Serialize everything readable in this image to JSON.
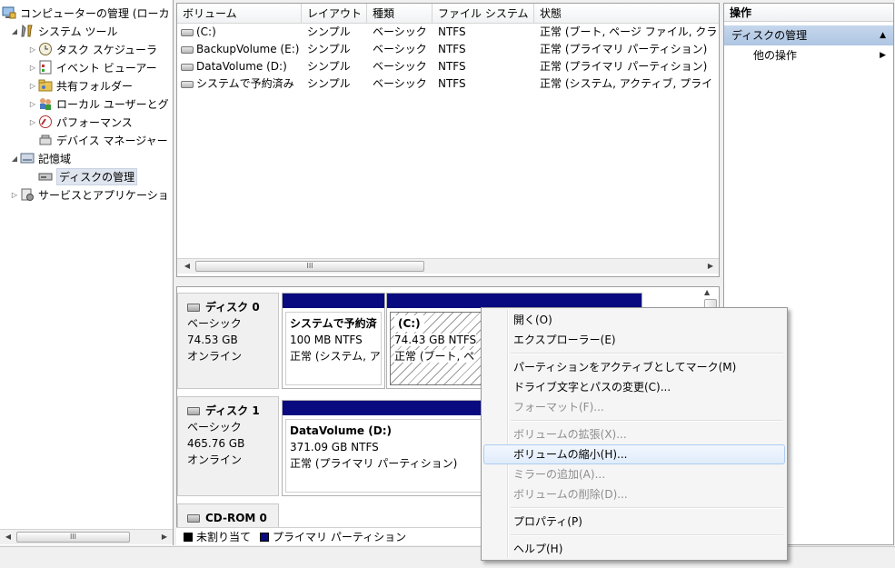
{
  "tree": {
    "items": [
      {
        "label": "コンピューターの管理 (ローカ",
        "icon": "computer-management-icon"
      },
      {
        "label": "システム ツール",
        "icon": "system-tools-icon"
      },
      {
        "label": "タスク スケジューラ",
        "icon": "clock-icon"
      },
      {
        "label": "イベント ビューアー",
        "icon": "event-viewer-icon"
      },
      {
        "label": "共有フォルダー",
        "icon": "shared-folder-icon"
      },
      {
        "label": "ローカル ユーザーとグ",
        "icon": "users-icon"
      },
      {
        "label": "パフォーマンス",
        "icon": "performance-icon"
      },
      {
        "label": "デバイス マネージャー",
        "icon": "device-manager-icon"
      },
      {
        "label": "記憶域",
        "icon": "storage-icon"
      },
      {
        "label": "ディスクの管理",
        "icon": "disk-management-icon"
      },
      {
        "label": "サービスとアプリケーショ",
        "icon": "services-icon"
      }
    ],
    "scroll_grip": "III"
  },
  "volumes": {
    "headers": [
      "ボリューム",
      "レイアウト",
      "種類",
      "ファイル システム",
      "状態"
    ],
    "rows": [
      {
        "name": "(C:)",
        "layout": "シンプル",
        "type": "ベーシック",
        "fs": "NTFS",
        "status": "正常 (ブート, ページ ファイル, クラ"
      },
      {
        "name": "BackupVolume (E:)",
        "layout": "シンプル",
        "type": "ベーシック",
        "fs": "NTFS",
        "status": "正常 (プライマリ パーティション)"
      },
      {
        "name": "DataVolume (D:)",
        "layout": "シンプル",
        "type": "ベーシック",
        "fs": "NTFS",
        "status": "正常 (プライマリ パーティション)"
      },
      {
        "name": "システムで予約済み",
        "layout": "シンプル",
        "type": "ベーシック",
        "fs": "NTFS",
        "status": "正常 (システム, アクティブ, プライ"
      }
    ],
    "scroll_grip": "III"
  },
  "disks": [
    {
      "name": "ディスク 0",
      "type": "ベーシック",
      "size": "74.53 GB",
      "state": "オンライン",
      "partitions": [
        {
          "title": "システムで予約済",
          "size": "100 MB NTFS",
          "status": "正常 (システム, ア"
        },
        {
          "title": "(C:)",
          "size": "74.43 GB NTFS",
          "status": "正常 (ブート, ペ"
        }
      ]
    },
    {
      "name": "ディスク 1",
      "type": "ベーシック",
      "size": "465.76 GB",
      "state": "オンライン",
      "partitions": [
        {
          "title": "DataVolume  (D:)",
          "size": "371.09 GB NTFS",
          "status": "正常 (プライマリ パーティション)"
        }
      ]
    },
    {
      "name": "CD-ROM 0"
    }
  ],
  "legend": {
    "unallocated": "未割り当て",
    "primary": "プライマリ パーティション",
    "unallocated_color": "#000000",
    "primary_color": "#0a0a80"
  },
  "actions": {
    "header": "操作",
    "section": "ディスクの管理",
    "more": "他の操作"
  },
  "context_menu": {
    "items": [
      {
        "label": "開く(O)",
        "enabled": true
      },
      {
        "label": "エクスプローラー(E)",
        "enabled": true
      },
      {
        "sep": true
      },
      {
        "label": "パーティションをアクティブとしてマーク(M)",
        "enabled": true
      },
      {
        "label": "ドライブ文字とパスの変更(C)...",
        "enabled": true
      },
      {
        "label": "フォーマット(F)...",
        "enabled": false
      },
      {
        "sep": true
      },
      {
        "label": "ボリュームの拡張(X)...",
        "enabled": false
      },
      {
        "label": "ボリュームの縮小(H)...",
        "enabled": true,
        "highlighted": true
      },
      {
        "label": "ミラーの追加(A)...",
        "enabled": false
      },
      {
        "label": "ボリュームの削除(D)...",
        "enabled": false
      },
      {
        "sep": true
      },
      {
        "label": "プロパティ(P)",
        "enabled": true
      },
      {
        "sep": true
      },
      {
        "label": "ヘルプ(H)",
        "enabled": true
      }
    ]
  }
}
